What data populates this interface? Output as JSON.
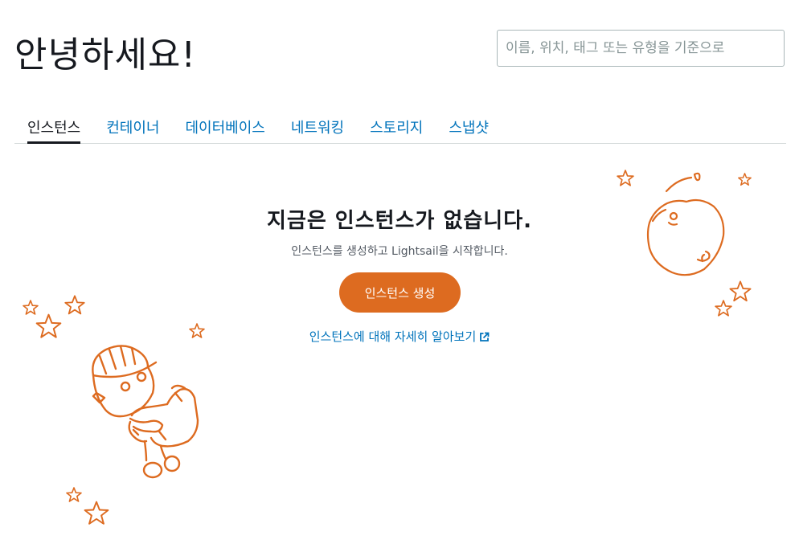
{
  "header": {
    "greeting": "안녕하세요!"
  },
  "search": {
    "placeholder": "이름, 위치, 태그 또는 유형을 기준으로"
  },
  "tabs": [
    {
      "label": "인스턴스",
      "active": true
    },
    {
      "label": "컨테이너",
      "active": false
    },
    {
      "label": "데이터베이스",
      "active": false
    },
    {
      "label": "네트워킹",
      "active": false
    },
    {
      "label": "스토리지",
      "active": false
    },
    {
      "label": "스냅샷",
      "active": false
    }
  ],
  "empty_state": {
    "title": "지금은 인스턴스가 없습니다.",
    "description": "인스턴스를 생성하고 Lightsail을 시작합니다.",
    "create_button": "인스턴스 생성",
    "learn_more": "인스턴스에 대해 자세히 알아보기"
  },
  "colors": {
    "accent": "#dd6b20",
    "link": "#0073bb",
    "text": "#16191f",
    "illustration": "#dd6b20"
  },
  "icons": {
    "external_link": "external-link-icon",
    "robot": "robot-illustration",
    "planet": "planet-illustration",
    "star": "star-icon"
  }
}
